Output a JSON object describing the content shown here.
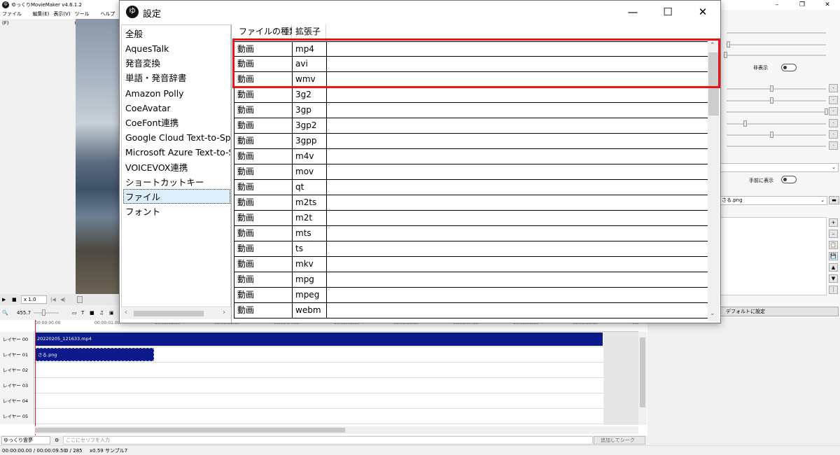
{
  "app": {
    "title": "ゆっくりMovieMaker v4.6.1.2",
    "icon_text": "ゆ",
    "menu": [
      "ファイル(F)",
      "編集(E)",
      "表示(V)",
      "ツール(T)",
      "ヘルプ(H)"
    ],
    "win_minimize": "–",
    "win_maximize": "❐",
    "win_close": "✕"
  },
  "playback": {
    "play": "▶",
    "stop": "■",
    "speed": "x 1.0"
  },
  "zoom": {
    "value": "455.7"
  },
  "right_panel": {
    "hide_label": "非表示",
    "front_label": "手前に表示",
    "file_combo_value": "さる.png",
    "default_button": "デフォルトに設定",
    "side_buttons": [
      "+",
      "–",
      "📋",
      "💾",
      "▲",
      "▼",
      "⋮"
    ]
  },
  "timeline": {
    "ticks": [
      "00:00:00.00",
      "00:00:01.00",
      "00:00:02.00",
      "00:00:03.00",
      "00:00:04.00",
      "00:00:05.00",
      "00:00:06.00",
      "00:00:07.00",
      "00:00:08.00",
      "00:00:09.00",
      "00:"
    ],
    "layers": [
      "レイヤー 00",
      "レイヤー 01",
      "レイヤー 02",
      "レイヤー 03",
      "レイヤー 04",
      "レイヤー 05"
    ],
    "clips": [
      {
        "layer": 0,
        "label": "20220205_121633.mp4"
      },
      {
        "layer": 1,
        "label": "さる.png"
      }
    ]
  },
  "bottom": {
    "voice": "ゆっくり霊夢",
    "serif_placeholder": "ここにセリフを入力",
    "add_button": "追加してシーク"
  },
  "status": {
    "time": "00:00:00.00 / 00:00:09.50",
    "frames": "0 / 285",
    "scale": "x0.59",
    "sample": "サンプル7"
  },
  "dialog": {
    "title": "設定",
    "icon_text": "ゆ",
    "minimize": "—",
    "maximize": "☐",
    "close": "✕",
    "nav": [
      "全般",
      "AquesTalk",
      "発音変換",
      "単語・発音辞書",
      "Amazon Polly",
      "CoeAvatar",
      "CoeFont連携",
      "Google Cloud Text-to-Speech",
      "Microsoft Azure Text-to-Speech",
      "VOICEVOX連携",
      "ショートカットキー",
      "ファイル",
      "フォント"
    ],
    "nav_selected": 11,
    "columns": [
      "ファイルの種類",
      "拡張子"
    ],
    "rows": [
      [
        "動画",
        "mp4"
      ],
      [
        "動画",
        "avi"
      ],
      [
        "動画",
        "wmv"
      ],
      [
        "動画",
        "3g2"
      ],
      [
        "動画",
        "3gp"
      ],
      [
        "動画",
        "3gp2"
      ],
      [
        "動画",
        "3gpp"
      ],
      [
        "動画",
        "m4v"
      ],
      [
        "動画",
        "mov"
      ],
      [
        "動画",
        "qt"
      ],
      [
        "動画",
        "m2ts"
      ],
      [
        "動画",
        "m2t"
      ],
      [
        "動画",
        "mts"
      ],
      [
        "動画",
        "ts"
      ],
      [
        "動画",
        "mkv"
      ],
      [
        "動画",
        "mpg"
      ],
      [
        "動画",
        "mpeg"
      ],
      [
        "動画",
        "webm"
      ]
    ],
    "highlight_color": "#e8141b"
  }
}
